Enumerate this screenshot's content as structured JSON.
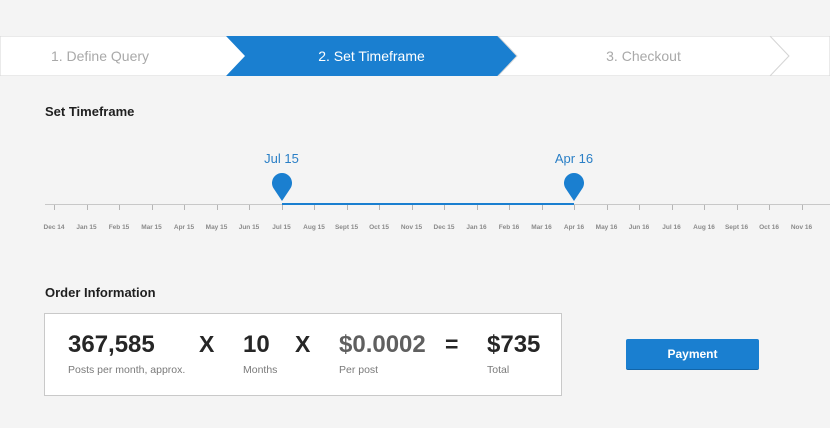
{
  "stepper": {
    "steps": [
      {
        "label": "1. Define Query",
        "state": "inactive"
      },
      {
        "label": "2. Set Timeframe",
        "state": "active"
      },
      {
        "label": "3. Checkout",
        "state": "inactive"
      }
    ],
    "active_color": "#1a7fd0"
  },
  "timeframe": {
    "title": "Set Timeframe",
    "start_label": "Jul 15",
    "end_label": "Apr 16",
    "start_index": 7,
    "end_index": 16,
    "months": [
      "Dec 14",
      "Jan 15",
      "Feb 15",
      "Mar 15",
      "Apr 15",
      "May 15",
      "Jun 15",
      "Jul 15",
      "Aug 15",
      "Sept 15",
      "Oct 15",
      "Nov 15",
      "Dec 15",
      "Jan 16",
      "Feb 16",
      "Mar 16",
      "Apr 16",
      "May 16",
      "Jun 16",
      "Jul 16",
      "Aug 16",
      "Sept 16",
      "Oct 16",
      "Nov 16"
    ],
    "marker_icon": "map-pin-icon"
  },
  "order": {
    "title": "Order Information",
    "posts_value": "367,585",
    "posts_label": "Posts per month, approx.",
    "multiply_1": "X",
    "months_value": "10",
    "months_label": "Months",
    "multiply_2": "X",
    "price_value": "$0.0002",
    "price_label": "Per post",
    "equals": "=",
    "total_value": "$735",
    "total_label": "Total"
  },
  "payment_button": {
    "label": "Payment"
  }
}
